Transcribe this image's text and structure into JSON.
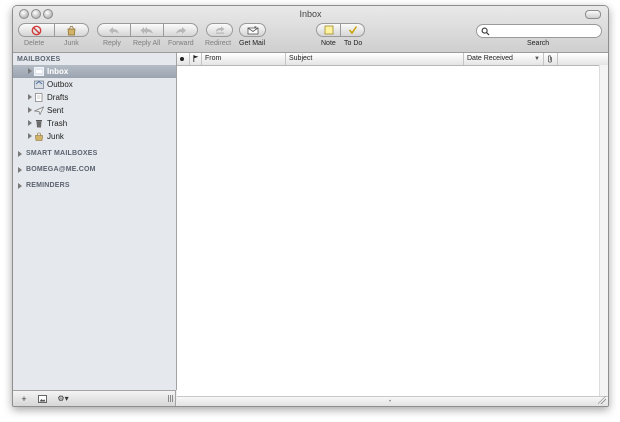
{
  "window": {
    "title": "Inbox"
  },
  "toolbar": {
    "delete": "Delete",
    "junk": "Junk",
    "reply": "Reply",
    "reply_all": "Reply All",
    "forward": "Forward",
    "redirect": "Redirect",
    "get_mail": "Get Mail",
    "note": "Note",
    "todo": "To Do",
    "search_label": "Search",
    "search_value": ""
  },
  "sidebar": {
    "mailboxes_header": "MAILBOXES",
    "items": [
      {
        "label": "Inbox",
        "icon": "inbox-icon",
        "selected": true
      },
      {
        "label": "Outbox",
        "icon": "outbox-icon"
      },
      {
        "label": "Drafts",
        "icon": "drafts-icon"
      },
      {
        "label": "Sent",
        "icon": "sent-icon"
      },
      {
        "label": "Trash",
        "icon": "trash-icon"
      },
      {
        "label": "Junk",
        "icon": "junk-icon"
      }
    ],
    "smart_mailboxes": "SMART MAILBOXES",
    "account": "BOMEGA@ME.COM",
    "reminders": "REMINDERS",
    "bottom_buttons": {
      "add": "+",
      "gear": "⚙▾"
    }
  },
  "list": {
    "columns": {
      "from": "From",
      "subject": "Subject",
      "date": "Date Received"
    }
  },
  "colors": {
    "selection": "#9aa4b0",
    "sidebar_bg": "#e5e8ec",
    "delete_red": "#d23b3b"
  }
}
